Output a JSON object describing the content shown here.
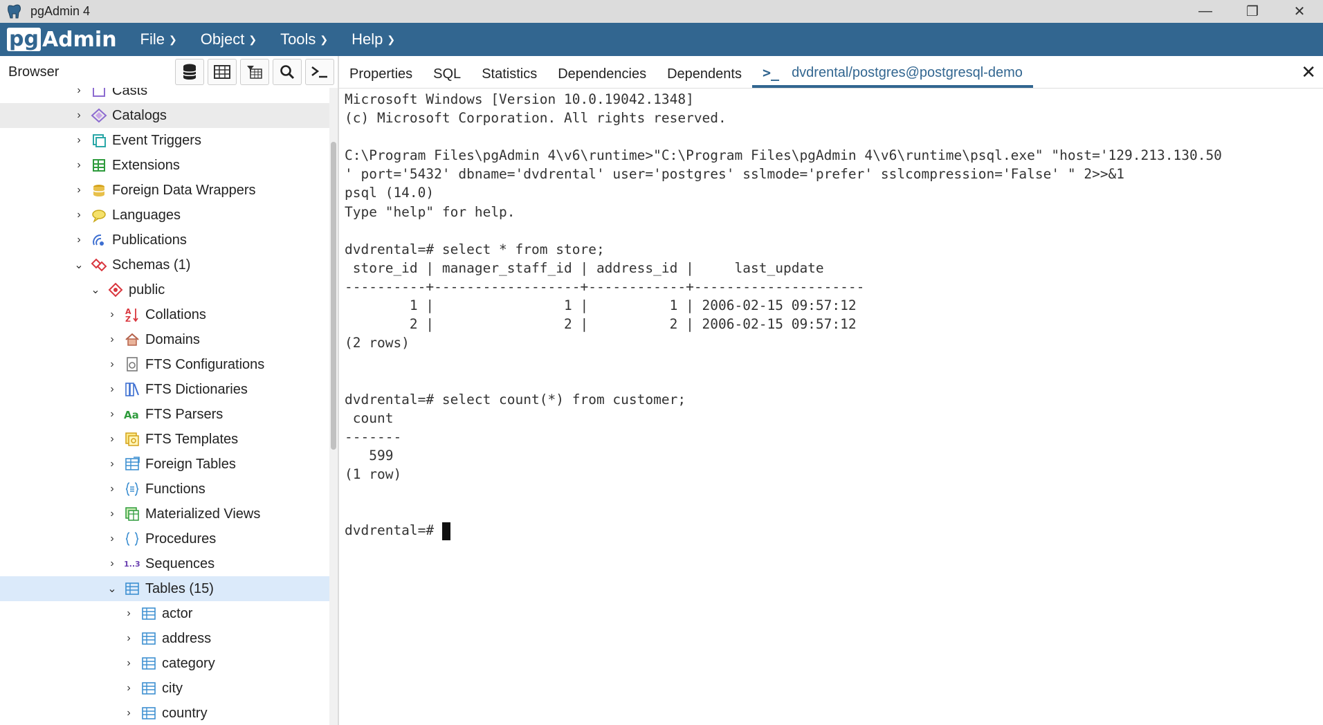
{
  "window": {
    "title": "pgAdmin 4",
    "controls": {
      "minimize": "—",
      "restore": "❐",
      "close": "✕"
    }
  },
  "menubar": {
    "logo_pg": "pg",
    "logo_admin": "Admin",
    "items": [
      "File",
      "Object",
      "Tools",
      "Help"
    ]
  },
  "browser": {
    "label": "Browser",
    "tools": [
      "database-icon",
      "table-grid-icon",
      "filtered-rows-icon",
      "search-icon",
      "terminal-icon"
    ]
  },
  "tree": {
    "items": [
      {
        "label": "Casts",
        "icon": "casts-icon",
        "state": "collapsed"
      },
      {
        "label": "Catalogs",
        "icon": "catalogs-icon",
        "state": "collapsed"
      },
      {
        "label": "Event Triggers",
        "icon": "event-triggers-icon",
        "state": "collapsed"
      },
      {
        "label": "Extensions",
        "icon": "extensions-icon",
        "state": "collapsed"
      },
      {
        "label": "Foreign Data Wrappers",
        "icon": "foreign-data-wrappers-icon",
        "state": "collapsed"
      },
      {
        "label": "Languages",
        "icon": "languages-icon",
        "state": "collapsed"
      },
      {
        "label": "Publications",
        "icon": "publications-icon",
        "state": "collapsed"
      },
      {
        "label": "Schemas (1)",
        "icon": "schemas-icon",
        "state": "expanded"
      },
      {
        "label": "public",
        "icon": "schema-icon",
        "state": "expanded"
      },
      {
        "label": "Collations",
        "icon": "collations-icon",
        "state": "collapsed"
      },
      {
        "label": "Domains",
        "icon": "domains-icon",
        "state": "collapsed"
      },
      {
        "label": "FTS Configurations",
        "icon": "fts-configurations-icon",
        "state": "collapsed"
      },
      {
        "label": "FTS Dictionaries",
        "icon": "fts-dictionaries-icon",
        "state": "collapsed"
      },
      {
        "label": "FTS Parsers",
        "icon": "fts-parsers-icon",
        "state": "collapsed"
      },
      {
        "label": "FTS Templates",
        "icon": "fts-templates-icon",
        "state": "collapsed"
      },
      {
        "label": "Foreign Tables",
        "icon": "foreign-tables-icon",
        "state": "collapsed"
      },
      {
        "label": "Functions",
        "icon": "functions-icon",
        "state": "collapsed"
      },
      {
        "label": "Materialized Views",
        "icon": "materialized-views-icon",
        "state": "collapsed"
      },
      {
        "label": "Procedures",
        "icon": "procedures-icon",
        "state": "collapsed"
      },
      {
        "label": "Sequences",
        "icon": "sequences-icon",
        "state": "collapsed"
      },
      {
        "label": "Tables (15)",
        "icon": "tables-icon",
        "state": "expanded"
      },
      {
        "label": "actor",
        "icon": "table-icon",
        "state": "collapsed"
      },
      {
        "label": "address",
        "icon": "table-icon",
        "state": "collapsed"
      },
      {
        "label": "category",
        "icon": "table-icon",
        "state": "collapsed"
      },
      {
        "label": "city",
        "icon": "table-icon",
        "state": "collapsed"
      },
      {
        "label": "country",
        "icon": "table-icon",
        "state": "collapsed"
      }
    ]
  },
  "tabs": {
    "items": [
      "Properties",
      "SQL",
      "Statistics",
      "Dependencies",
      "Dependents"
    ],
    "active_symbol": ">_",
    "active": "dvdrental/postgres@postgresql-demo",
    "close": "✕"
  },
  "terminal": {
    "lines": [
      "Microsoft Windows [Version 10.0.19042.1348]",
      "(c) Microsoft Corporation. All rights reserved.",
      "",
      "C:\\Program Files\\pgAdmin 4\\v6\\runtime>\"C:\\Program Files\\pgAdmin 4\\v6\\runtime\\psql.exe\" \"host='129.213.130.50",
      "' port='5432' dbname='dvdrental' user='postgres' sslmode='prefer' sslcompression='False' \" 2>>&1",
      "psql (14.0)",
      "Type \"help\" for help.",
      "",
      "dvdrental=# select * from store;",
      " store_id | manager_staff_id | address_id |     last_update",
      "----------+------------------+------------+---------------------",
      "        1 |                1 |          1 | 2006-02-15 09:57:12",
      "        2 |                2 |          2 | 2006-02-15 09:57:12",
      "(2 rows)",
      "",
      "",
      "dvdrental=# select count(*) from customer;",
      " count",
      "-------",
      "   599",
      "(1 row)",
      "",
      ""
    ],
    "prompt": "dvdrental=# "
  }
}
